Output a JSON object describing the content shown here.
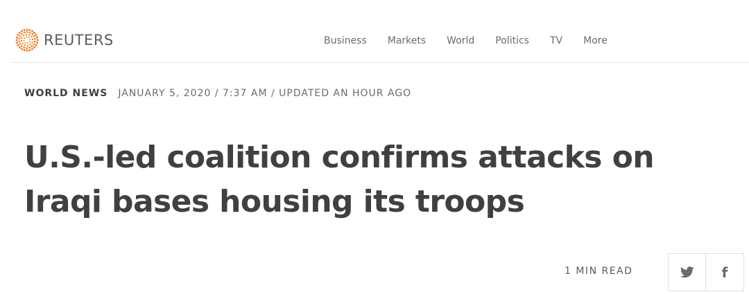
{
  "header": {
    "logo_text": "REUTERS",
    "nav": [
      {
        "label": "Business"
      },
      {
        "label": "Markets"
      },
      {
        "label": "World"
      },
      {
        "label": "Politics"
      },
      {
        "label": "TV"
      },
      {
        "label": "More"
      }
    ]
  },
  "article": {
    "section": "WORLD NEWS",
    "dateline": "JANUARY 5, 2020 / 7:37 AM / UPDATED AN HOUR AGO",
    "headline": "U.S.-led coalition confirms attacks on Iraqi bases housing its troops",
    "read_time": "1 MIN READ"
  },
  "share": {
    "twitter_icon": "twitter-icon",
    "facebook_icon": "facebook-icon",
    "facebook_glyph": "f"
  },
  "colors": {
    "brand_orange": "#f07e26",
    "text_dark": "#404040",
    "text_muted": "#6b6b6b",
    "divider": "#e6e6e6"
  }
}
